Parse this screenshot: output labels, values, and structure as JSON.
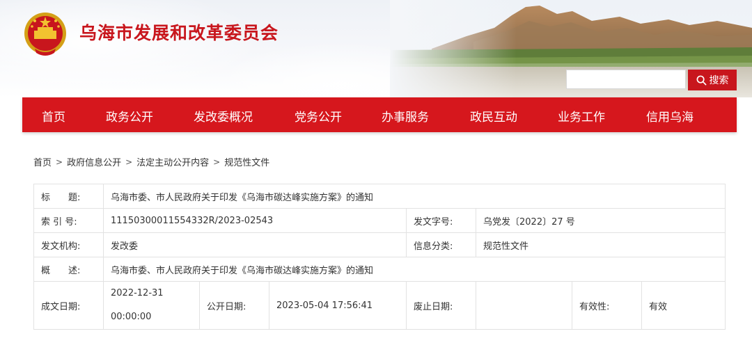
{
  "site": {
    "title": "乌海市发展和改革委员会"
  },
  "icons": {
    "emblem": "national-emblem",
    "search": "search-icon"
  },
  "search": {
    "button_label": "搜索",
    "placeholder": ""
  },
  "nav": {
    "items": [
      {
        "label": "首页"
      },
      {
        "label": "政务公开"
      },
      {
        "label": "发改委概况"
      },
      {
        "label": "党务公开"
      },
      {
        "label": "办事服务"
      },
      {
        "label": "政民互动"
      },
      {
        "label": "业务工作"
      },
      {
        "label": "信用乌海"
      }
    ]
  },
  "breadcrumb": [
    "首页",
    "政府信息公开",
    "法定主动公开内容",
    "规范性文件"
  ],
  "info": {
    "title_label": "标　　题:",
    "title_value": "乌海市委、市人民政府关于印发《乌海市碳达峰实施方案》的通知",
    "index_label": "索 引 号:",
    "index_value": "11150300011554332R/2023-02543",
    "doc_no_label": "发文字号:",
    "doc_no_value": "乌党发〔2022〕27 号",
    "org_label": "发文机构:",
    "org_value": "发改委",
    "category_label": "信息分类:",
    "category_value": "规范性文件",
    "summary_label": "概　　述:",
    "summary_value": "乌海市委、市人民政府关于印发《乌海市碳达峰实施方案》的通知",
    "created_label": "成文日期:",
    "created_date": "2022-12-31",
    "created_time": "00:00:00",
    "published_label": "公开日期:",
    "published_value": "2023-05-04 17:56:41",
    "expire_label": "废止日期:",
    "expire_value": "",
    "validity_label": "有效性:",
    "validity_value": "有效"
  },
  "colors": {
    "brand_red": "#d6171d",
    "title_red": "#c8161d"
  }
}
